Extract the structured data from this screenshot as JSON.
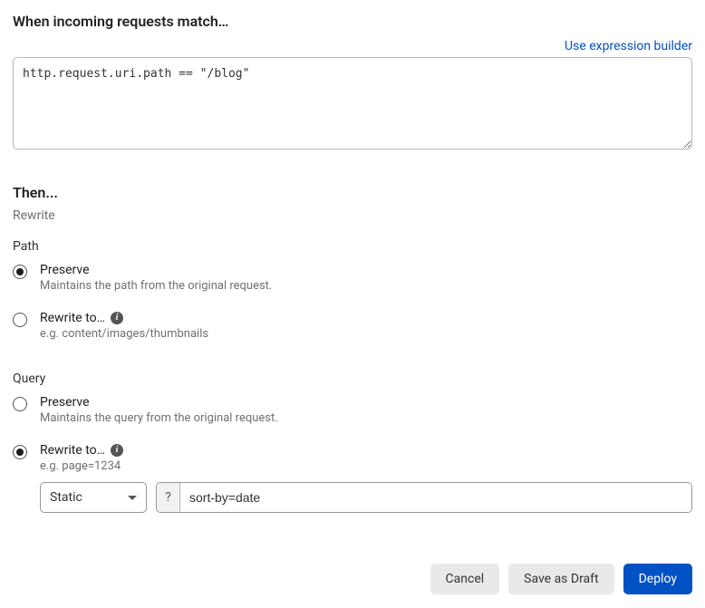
{
  "when": {
    "title": "When incoming requests match…",
    "builder_link": "Use expression builder",
    "expression": "http.request.uri.path == \"/blog\""
  },
  "then": {
    "title": "Then...",
    "action": "Rewrite"
  },
  "path": {
    "label": "Path",
    "preserve": {
      "label": "Preserve",
      "hint": "Maintains the path from the original request.",
      "selected": true
    },
    "rewrite": {
      "label": "Rewrite to…",
      "hint": "e.g. content/images/thumbnails",
      "selected": false
    }
  },
  "query": {
    "label": "Query",
    "preserve": {
      "label": "Preserve",
      "hint": "Maintains the query from the original request.",
      "selected": false
    },
    "rewrite": {
      "label": "Rewrite to…",
      "hint": "e.g. page=1234",
      "selected": true,
      "mode": "Static",
      "prefix": "?",
      "value": "sort-by=date"
    }
  },
  "footer": {
    "cancel": "Cancel",
    "save_draft": "Save as Draft",
    "deploy": "Deploy"
  }
}
